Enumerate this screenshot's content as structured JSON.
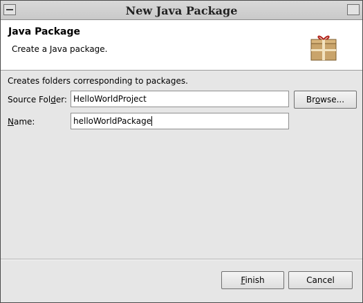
{
  "window": {
    "title": "New Java Package"
  },
  "header": {
    "title": "Java Package",
    "description": "Create a Java package.",
    "icon": "package-icon"
  },
  "form": {
    "description": "Creates folders corresponding to packages.",
    "source_folder": {
      "label_pre": "Source Fol",
      "label_mnemonic": "d",
      "label_post": "er:",
      "value": "HelloWorldProject"
    },
    "browse": {
      "label_pre": "Br",
      "label_mnemonic": "o",
      "label_post": "wse..."
    },
    "name": {
      "label_mnemonic": "N",
      "label_post": "ame:",
      "value": "helloWorldPackage"
    }
  },
  "footer": {
    "finish": {
      "label_mnemonic": "F",
      "label_post": "inish"
    },
    "cancel": {
      "label": "Cancel"
    }
  },
  "colors": {
    "header_bg": "#ffffff",
    "dialog_bg": "#e6e6e6"
  }
}
